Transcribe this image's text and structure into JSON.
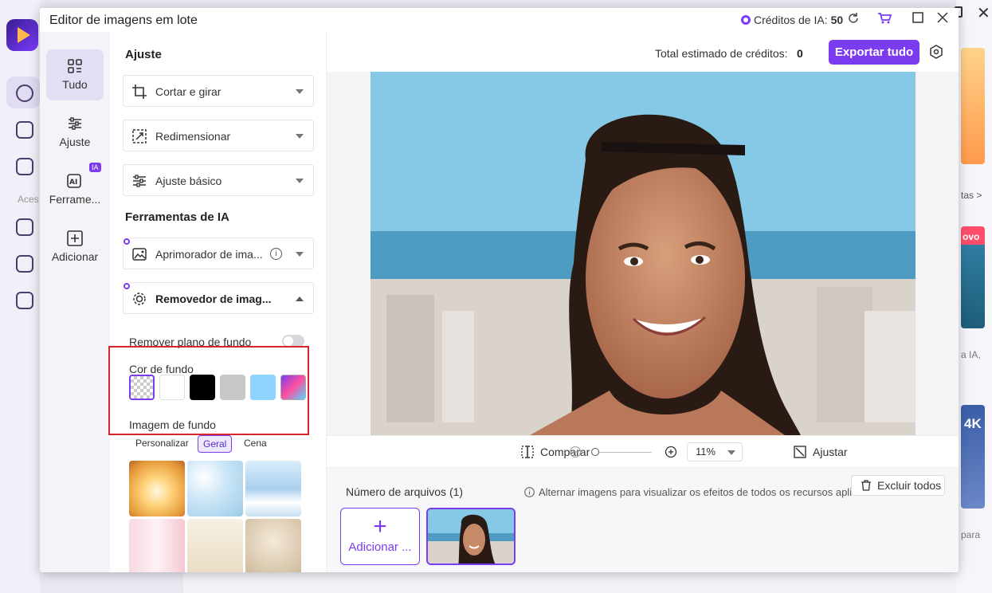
{
  "window": {
    "title": "Editor de imagens em lote",
    "credits_label": "Créditos de IA:",
    "credits_value": "50"
  },
  "rail": {
    "items": [
      {
        "label": "Tudo"
      },
      {
        "label": "Ajuste"
      },
      {
        "label": "Ferrame..."
      },
      {
        "label": "Adicionar"
      }
    ],
    "ia_badge": "IA"
  },
  "panel": {
    "section_adjust": "Ajuste",
    "crop": "Cortar e girar",
    "resize": "Redimensionar",
    "basic": "Ajuste básico",
    "section_ai": "Ferramentas de IA",
    "enhancer": "Aprimorador de ima...",
    "remover": "Removedor de imag...",
    "remove_bg": "Remover plano de fundo",
    "bg_color": "Cor de fundo",
    "bg_image": "Imagem de fundo",
    "tabs": [
      "Personalizar",
      "Geral",
      "Cena"
    ],
    "swatch_colors": [
      "checker",
      "#ffffff",
      "#000000",
      "#c8c8c8",
      "#8fd3ff",
      "gradient"
    ]
  },
  "topbar": {
    "total_label": "Total estimado de créditos:",
    "total_value": "0",
    "export": "Exportar tudo"
  },
  "zoombar": {
    "compare": "Comparar",
    "zoom": "11%",
    "fit": "Ajustar"
  },
  "files": {
    "count": "Número de arquivos (1)",
    "hint": "Alternar imagens para visualizar os efeitos de todos os recursos aplic...",
    "clear": "Excluir todos",
    "add": "Adicionar ..."
  },
  "background": {
    "sidebar_label": "Aces",
    "right_texts": [
      "tas >",
      "ovo",
      "a IA,",
      "4K",
      "para"
    ]
  },
  "colors": {
    "accent": "#7b3cf0",
    "highlight_box": "#d6262b"
  }
}
